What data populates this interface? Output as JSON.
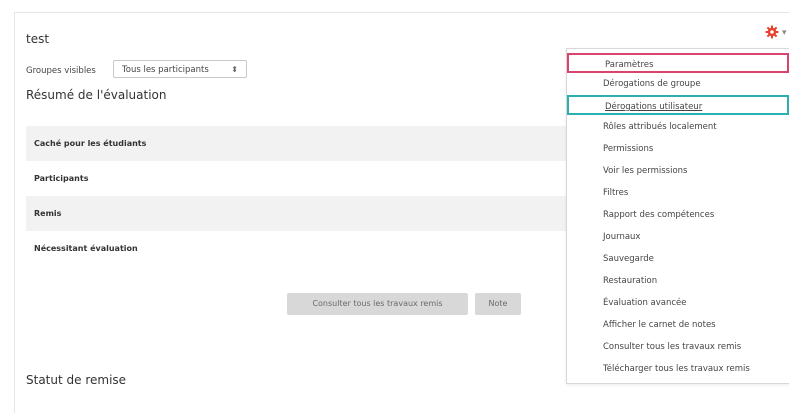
{
  "page": {
    "title": "test"
  },
  "groups": {
    "label": "Groupes visibles",
    "selected": "Tous les participants"
  },
  "summary": {
    "heading": "Résumé de l'évaluation",
    "rows": [
      "Caché pour les étudiants",
      "Participants",
      "Remis",
      "Nécessitant évaluation"
    ],
    "view_all_button": "Consulter tous les travaux remis",
    "grade_button": "Note"
  },
  "status": {
    "heading": "Statut de remise"
  },
  "menu": {
    "items": [
      "Paramètres",
      "Dérogations de groupe",
      "Dérogations utilisateur",
      "Rôles attribués localement",
      "Permissions",
      "Voir les permissions",
      "Filtres",
      "Rapport des compétences",
      "Journaux",
      "Sauvegarde",
      "Restauration",
      "Évaluation avancée",
      "Afficher le carnet de notes",
      "Consulter tous les travaux remis",
      "Télécharger tous les travaux remis"
    ]
  },
  "colors": {
    "gear": "#e8402c",
    "highlight_pink": "#d9436d",
    "highlight_teal": "#2ab0b0"
  },
  "icons": {
    "gear": "gear-icon",
    "select_arrows": "sort-arrows-icon"
  }
}
